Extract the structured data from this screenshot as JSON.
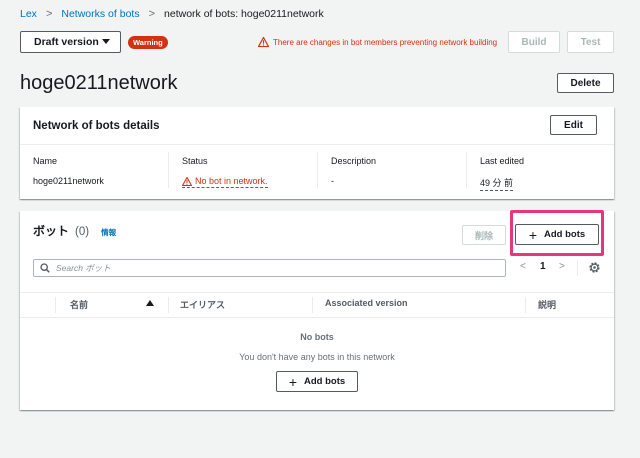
{
  "breadcrumb": {
    "item1": "Lex",
    "item2": "Networks of bots",
    "current": "network of bots: hoge0211network",
    "sep": ">"
  },
  "toolbar": {
    "version_select": "Draft version",
    "warning_badge": "Warning",
    "warning_message": "There are changes in bot members preventing network building",
    "build_label": "Build",
    "test_label": "Test"
  },
  "page": {
    "title": "hoge0211network",
    "delete_label": "Delete"
  },
  "details": {
    "heading": "Network of bots details",
    "edit_label": "Edit",
    "name_key": "Name",
    "name_value": "hoge0211network",
    "status_key": "Status",
    "status_value": "No bot in network.",
    "description_key": "Description",
    "description_value": "-",
    "edited_key": "Last edited",
    "edited_value": "49 分 前"
  },
  "bots": {
    "heading": "ボット",
    "count": "(0)",
    "info_link": "情報",
    "delete_label": "削除",
    "add_label": "Add bots",
    "add_plus": "+",
    "search_placeholder": "Search ボット",
    "pagination": {
      "prev": "<",
      "page": "1",
      "next": ">"
    },
    "columns": [
      "名前",
      "エイリアス",
      "Associated version",
      "説明"
    ],
    "empty_title": "No bots",
    "empty_message": "You don't have any bots in this network",
    "empty_add_label": "Add bots"
  },
  "colors": {
    "accent": "#0073bb",
    "warning": "#d13212",
    "highlight": "#e5377c"
  },
  "icons": [
    "chevron-right-icon",
    "caret-down-icon",
    "warning-triangle-icon",
    "search-icon",
    "plus-icon",
    "sort-ascending-icon",
    "settings-gear-icon"
  ]
}
